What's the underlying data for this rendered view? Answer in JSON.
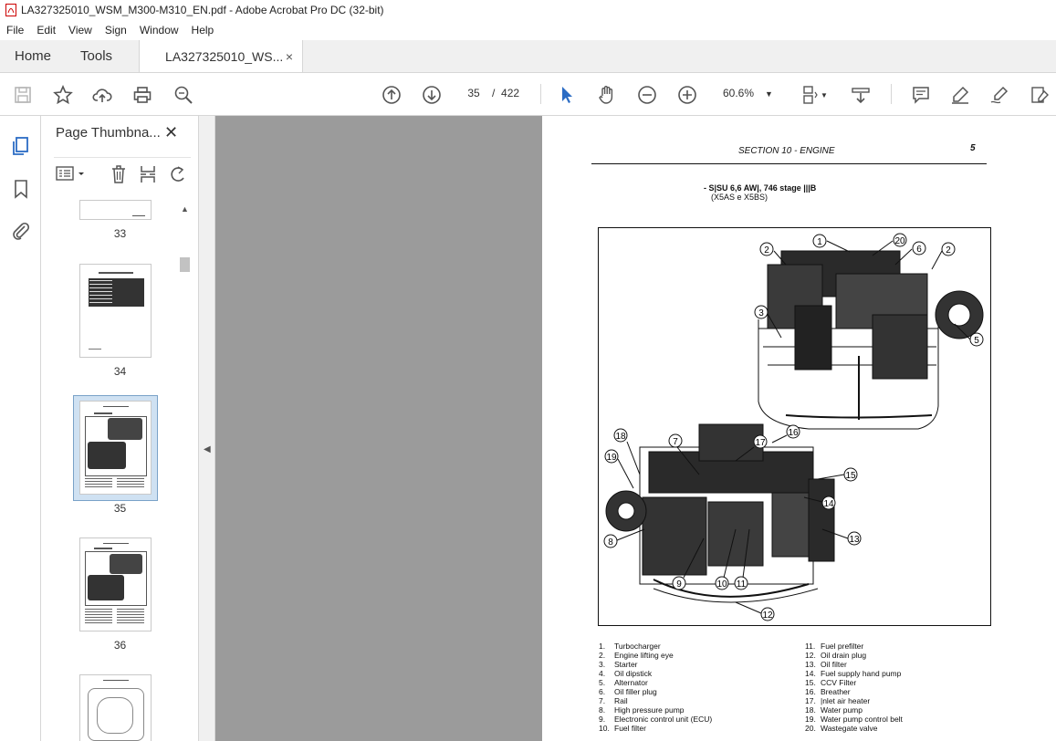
{
  "window": {
    "title": "LA327325010_WSM_M300-M310_EN.pdf - Adobe Acrobat Pro DC (32-bit)"
  },
  "menu": [
    "File",
    "Edit",
    "View",
    "Sign",
    "Window",
    "Help"
  ],
  "tabs": {
    "home": "Home",
    "tools": "Tools",
    "document": "LA327325010_WS...",
    "close": "×"
  },
  "toolbar": {
    "current_page": "35",
    "page_sep": "/",
    "total_pages": "422",
    "zoom": "60.6%"
  },
  "thumbnails": {
    "title": "Page Thumbna...",
    "close": "✕",
    "pages": [
      {
        "label": "33"
      },
      {
        "label": "34"
      },
      {
        "label": "35"
      },
      {
        "label": "36"
      }
    ],
    "selected": "35"
  },
  "document": {
    "section_header": "SECTION 10 - ENGINE",
    "page_number": "5",
    "engine_title": "- S|SU 6,6 AW|, 746 stage |||B",
    "engine_subtitle": "(X5AS e X5BS)",
    "callouts": [
      "1",
      "2",
      "3",
      "5",
      "6",
      "7",
      "8",
      "9",
      "10",
      "11",
      "12",
      "13",
      "14",
      "15",
      "16",
      "17",
      "18",
      "19",
      "20"
    ],
    "legend_left": [
      {
        "n": "1.",
        "t": "Turbocharger"
      },
      {
        "n": "2.",
        "t": "Engine lifting eye"
      },
      {
        "n": "3.",
        "t": "Starter"
      },
      {
        "n": "4.",
        "t": "Oil dipstick"
      },
      {
        "n": "5.",
        "t": "Alternator"
      },
      {
        "n": "6.",
        "t": "Oil filler plug"
      },
      {
        "n": "7.",
        "t": "Rail"
      },
      {
        "n": "8.",
        "t": "High pressure pump"
      },
      {
        "n": "9.",
        "t": "Electronic control unit (ECU)"
      },
      {
        "n": "10.",
        "t": "Fuel filter"
      }
    ],
    "legend_right": [
      {
        "n": "11.",
        "t": "Fuel prefilter"
      },
      {
        "n": "12.",
        "t": "Oil drain plug"
      },
      {
        "n": "13.",
        "t": "Oil filter"
      },
      {
        "n": "14.",
        "t": "Fuel supply hand pump"
      },
      {
        "n": "15.",
        "t": "CCV Filter"
      },
      {
        "n": "16.",
        "t": "Breather"
      },
      {
        "n": "17.",
        "t": "|nlet air heater"
      },
      {
        "n": "18.",
        "t": "Water pump"
      },
      {
        "n": "19.",
        "t": "Water pump control belt"
      },
      {
        "n": "20.",
        "t": "Wastegate valve"
      }
    ]
  }
}
